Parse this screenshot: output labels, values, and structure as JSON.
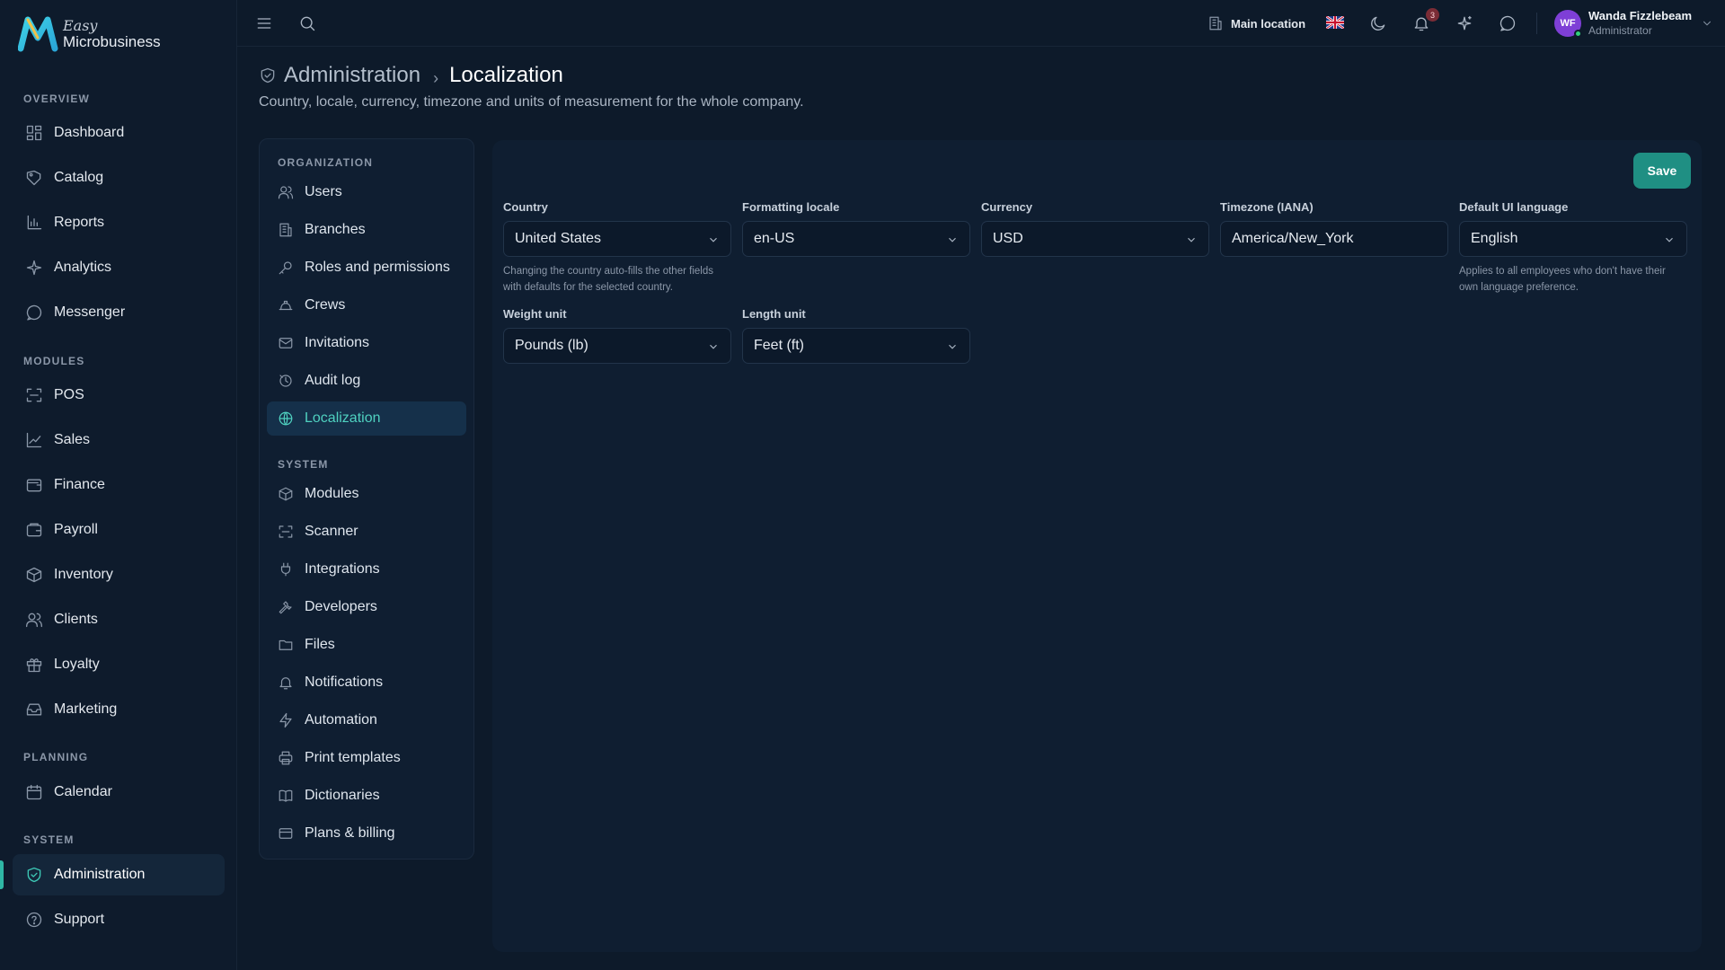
{
  "app": {
    "logo_top": "Easy",
    "logo_name": "Microbusiness"
  },
  "sidebar": {
    "sections": [
      {
        "label": "OVERVIEW"
      },
      {
        "label": "MODULES"
      },
      {
        "label": "PLANNING"
      },
      {
        "label": "SYSTEM"
      }
    ],
    "items": [
      {
        "label": "Dashboard",
        "icon": "dashboard-icon"
      },
      {
        "label": "Catalog",
        "icon": "catalog-icon"
      },
      {
        "label": "Reports",
        "icon": "reports-icon"
      },
      {
        "label": "Analytics",
        "icon": "analytics-icon"
      },
      {
        "label": "Messenger",
        "icon": "messenger-icon"
      },
      {
        "label": "POS",
        "icon": "pos-icon"
      },
      {
        "label": "Sales",
        "icon": "sales-icon"
      },
      {
        "label": "Finance",
        "icon": "finance-icon"
      },
      {
        "label": "Payroll",
        "icon": "payroll-icon"
      },
      {
        "label": "Inventory",
        "icon": "inventory-icon"
      },
      {
        "label": "Clients",
        "icon": "clients-icon"
      },
      {
        "label": "Loyalty",
        "icon": "loyalty-icon"
      },
      {
        "label": "Marketing",
        "icon": "marketing-icon"
      },
      {
        "label": "Calendar",
        "icon": "calendar-icon"
      },
      {
        "label": "Administration",
        "icon": "shield-icon",
        "active": true
      },
      {
        "label": "Support",
        "icon": "help-icon"
      }
    ]
  },
  "topbar": {
    "location": "Main location",
    "notifications_count": "3",
    "user_initials": "WF",
    "user_name": "Wanda Fizzlebeam",
    "user_role": "Administrator"
  },
  "page": {
    "breadcrumb_parent": "Administration",
    "breadcrumb_separator": "›",
    "title": "Localization",
    "subtitle": "Country, locale, currency, timezone and units of measurement for the whole company."
  },
  "settings_nav": {
    "sections": [
      {
        "label": "ORGANIZATION"
      },
      {
        "label": "SYSTEM"
      }
    ],
    "items": [
      {
        "label": "Users",
        "icon": "users-icon"
      },
      {
        "label": "Branches",
        "icon": "building-icon"
      },
      {
        "label": "Roles and permissions",
        "icon": "key-icon"
      },
      {
        "label": "Crews",
        "icon": "crews-icon"
      },
      {
        "label": "Invitations",
        "icon": "mail-icon"
      },
      {
        "label": "Audit log",
        "icon": "audit-icon"
      },
      {
        "label": "Localization",
        "icon": "globe-icon",
        "active": true
      },
      {
        "label": "Modules",
        "icon": "modules-icon"
      },
      {
        "label": "Scanner",
        "icon": "scanner-icon"
      },
      {
        "label": "Integrations",
        "icon": "plug-icon"
      },
      {
        "label": "Developers",
        "icon": "wrench-icon"
      },
      {
        "label": "Files",
        "icon": "folder-icon"
      },
      {
        "label": "Notifications",
        "icon": "bell-icon"
      },
      {
        "label": "Automation",
        "icon": "bolt-icon"
      },
      {
        "label": "Print templates",
        "icon": "printer-icon"
      },
      {
        "label": "Dictionaries",
        "icon": "book-icon"
      },
      {
        "label": "Plans & billing",
        "icon": "card-icon"
      }
    ]
  },
  "form": {
    "save_label": "Save",
    "country": {
      "label": "Country",
      "value": "United States",
      "hint": "Changing the country auto-fills the other fields with defaults for the selected country."
    },
    "locale": {
      "label": "Formatting locale",
      "value": "en-US"
    },
    "currency": {
      "label": "Currency",
      "value": "USD"
    },
    "timezone": {
      "label": "Timezone (IANA)",
      "value": "America/New_York"
    },
    "language": {
      "label": "Default UI language",
      "value": "English",
      "hint": "Applies to all employees who don't have their own language preference."
    },
    "weight": {
      "label": "Weight unit",
      "value": "Pounds (lb)"
    },
    "length": {
      "label": "Length unit",
      "value": "Feet (ft)"
    }
  },
  "colors": {
    "accent": "#1f8f83",
    "accent_text": "#4fd1c0",
    "background": "#0d1a2a",
    "panel": "#0f1e31"
  }
}
